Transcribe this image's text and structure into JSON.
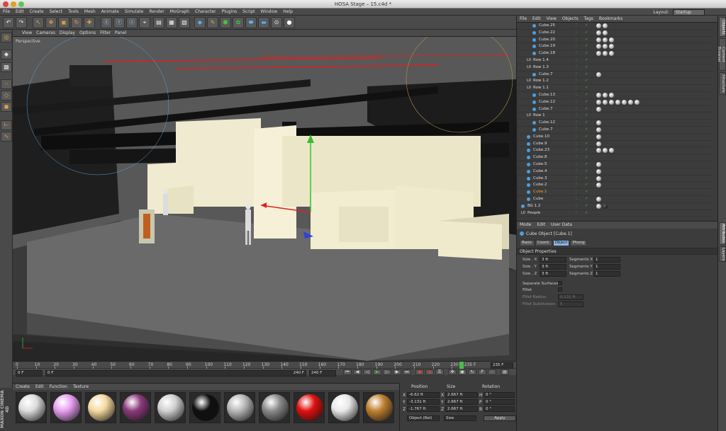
{
  "window": {
    "title": "HOSA Stage – 15.c4d *"
  },
  "menu": [
    "File",
    "Edit",
    "Create",
    "Select",
    "Tools",
    "Mesh",
    "Animate",
    "Simulate",
    "Render",
    "MoGraph",
    "Character",
    "Plugins",
    "Script",
    "Window",
    "Help"
  ],
  "layout": {
    "label": "Layout:",
    "value": "Startup"
  },
  "viewport": {
    "menu": [
      "View",
      "Cameras",
      "Display",
      "Options",
      "Filter",
      "Panel"
    ],
    "label": "Perspective"
  },
  "timeline": {
    "ticks": [
      "0",
      "10",
      "20",
      "30",
      "40",
      "50",
      "60",
      "70",
      "80",
      "90",
      "100",
      "110",
      "120",
      "130",
      "140",
      "150",
      "160",
      "170",
      "180",
      "190",
      "200",
      "210",
      "220",
      "230"
    ],
    "current_frame_label": "235 F",
    "right_field": "235 F",
    "start_field": "0 F",
    "start_field2": "0 F",
    "end_field": "240 F",
    "end_field2": "240 F",
    "playhead_frame": 235,
    "max_frame": 240
  },
  "material_manager": {
    "menu": [
      "Create",
      "Edit",
      "Function",
      "Texture"
    ],
    "materials": [
      {
        "color": "#dcdcdc"
      },
      {
        "color": "#e89ef0"
      },
      {
        "color": "#f6d9a0"
      },
      {
        "color": "#8a3a7a"
      },
      {
        "color": "#d0d0d0"
      },
      {
        "color": "#101010"
      },
      {
        "color": "#b8b8b8"
      },
      {
        "color": "#8a8a8a"
      },
      {
        "color": "#e01010"
      },
      {
        "color": "#e8e8e8"
      },
      {
        "color": "#c08030"
      }
    ]
  },
  "coordinates": {
    "headers": [
      "Position",
      "Size",
      "Rotation"
    ],
    "rows": [
      {
        "axis": "X",
        "pos": "-6.62 ft",
        "size_axis": "X",
        "size": "2.667 ft",
        "rot_axis": "H",
        "rot": "0 °"
      },
      {
        "axis": "Y",
        "pos": "-3.131 ft",
        "size_axis": "Y",
        "size": "2.667 ft",
        "rot_axis": "P",
        "rot": "0 °"
      },
      {
        "axis": "Z",
        "pos": "-1.767 ft",
        "size_axis": "Z",
        "size": "2.667 ft",
        "rot_axis": "B",
        "rot": "0 °"
      }
    ],
    "mode": "Object (Rel)",
    "size_mode": "Size",
    "apply": "Apply"
  },
  "object_manager": {
    "menu": [
      "File",
      "Edit",
      "View",
      "Objects",
      "Tags",
      "Bookmarks"
    ],
    "rows": [
      {
        "name": "Cube.25",
        "type": "cube",
        "indent": 2,
        "tags": 2
      },
      {
        "name": "Cube.22",
        "type": "cube",
        "indent": 2,
        "tags": 2
      },
      {
        "name": "Cube.20",
        "type": "cube",
        "indent": 2,
        "tags": 3
      },
      {
        "name": "Cube.19",
        "type": "cube",
        "indent": 2,
        "tags": 3
      },
      {
        "name": "Cube.18",
        "type": "cube",
        "indent": 2,
        "tags": 3
      },
      {
        "name": "Row 1.4",
        "type": "null",
        "indent": 1,
        "tags": 0
      },
      {
        "name": "Row 1.3",
        "type": "null",
        "indent": 1,
        "tags": 0
      },
      {
        "name": "Cube.7",
        "type": "cube",
        "indent": 2,
        "tags": 1
      },
      {
        "name": "Row 1.2",
        "type": "null",
        "indent": 1,
        "tags": 0
      },
      {
        "name": "Row 1.1",
        "type": "null",
        "indent": 1,
        "tags": 0
      },
      {
        "name": "Cube.13",
        "type": "cube",
        "indent": 2,
        "tags": 3
      },
      {
        "name": "Cube.12",
        "type": "cube",
        "indent": 2,
        "tags": 7
      },
      {
        "name": "Cube.7",
        "type": "cube",
        "indent": 2,
        "tags": 1
      },
      {
        "name": "Row 1",
        "type": "null",
        "indent": 1,
        "tags": 0
      },
      {
        "name": "Cube.12",
        "type": "cube",
        "indent": 2,
        "tags": 1
      },
      {
        "name": "Cube.7",
        "type": "cube",
        "indent": 2,
        "tags": 1
      },
      {
        "name": "Cube.10",
        "type": "cube",
        "indent": 1,
        "tags": 1
      },
      {
        "name": "Cube.9",
        "type": "cube",
        "indent": 1,
        "tags": 1
      },
      {
        "name": "Cube.23",
        "type": "cube",
        "indent": 1,
        "tags": 3
      },
      {
        "name": "Cube.8",
        "type": "cube",
        "indent": 1,
        "tags": 0
      },
      {
        "name": "Cube.5",
        "type": "cube",
        "indent": 1,
        "tags": 1
      },
      {
        "name": "Cube.4",
        "type": "cube",
        "indent": 1,
        "tags": 1
      },
      {
        "name": "Cube.3",
        "type": "cube",
        "indent": 1,
        "tags": 1
      },
      {
        "name": "Cube.2",
        "type": "cube",
        "indent": 1,
        "tags": 1
      },
      {
        "name": "Cube.1",
        "type": "cube",
        "indent": 1,
        "tags": 0,
        "selected": true
      },
      {
        "name": "Cube",
        "type": "cube",
        "indent": 1,
        "tags": 1
      },
      {
        "name": "BG 1.2",
        "type": "cube",
        "indent": 0,
        "tags": 2
      },
      {
        "name": "People",
        "type": "null",
        "indent": 0,
        "tags": 0
      }
    ]
  },
  "attributes": {
    "menu": [
      "Mode",
      "Edit",
      "User Data"
    ],
    "title": "Cube Object [Cube.1]",
    "tabs": [
      {
        "label": "Basic",
        "active": false
      },
      {
        "label": "Coord.",
        "active": false
      },
      {
        "label": "Object",
        "active": true
      },
      {
        "label": "Phong",
        "active": false
      }
    ],
    "section": "Object Properties",
    "size_x": {
      "label": "Size . X",
      "value": "3 ft"
    },
    "size_y": {
      "label": "Size . Y",
      "value": "3 ft"
    },
    "size_z": {
      "label": "Size . Z",
      "value": "3 ft"
    },
    "seg_x": {
      "label": "Segments X",
      "value": "1"
    },
    "seg_y": {
      "label": "Segments Y",
      "value": "1"
    },
    "seg_z": {
      "label": "Segments Z",
      "value": "1"
    },
    "separate_surfaces": "Separate Surfaces",
    "fillet": "Fillet",
    "fillet_radius": {
      "label": "Fillet Radius",
      "value": "0.131 ft"
    },
    "fillet_subdivision": {
      "label": "Fillet Subdivision",
      "value": "5"
    }
  },
  "side_tabs": [
    "Objects",
    "Content Browser",
    "Structure",
    "Attributes",
    "Layers"
  ],
  "logo": "MAXON CINEMA 4D"
}
